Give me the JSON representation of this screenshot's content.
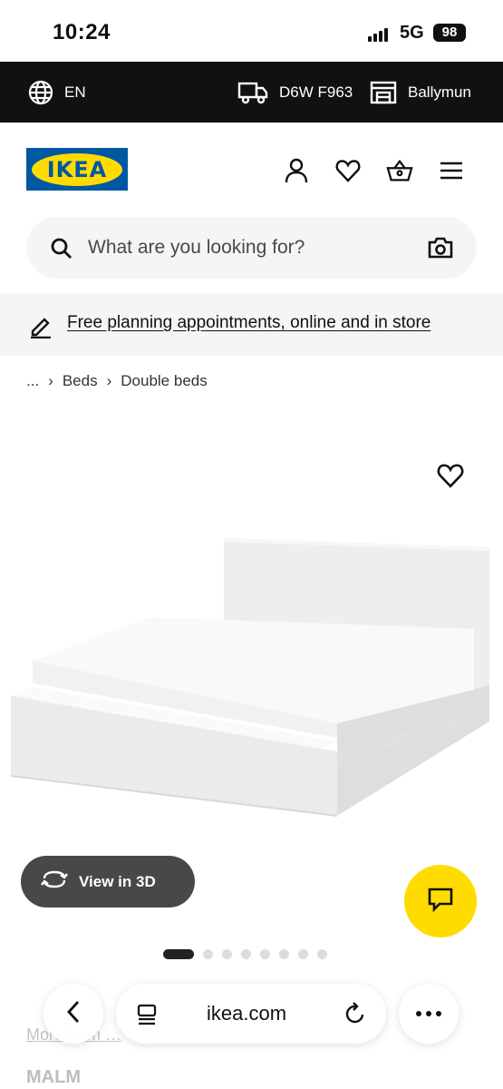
{
  "status_bar": {
    "time": "10:24",
    "network": "5G",
    "battery": "98"
  },
  "top_bar": {
    "language": "EN",
    "postcode": "D6W F963",
    "store": "Ballymun",
    "icons": [
      "globe-icon",
      "delivery-truck-icon",
      "store-icon"
    ]
  },
  "header": {
    "logo_text": "IKEA",
    "icons": [
      "profile-icon",
      "heart-icon",
      "basket-icon",
      "menu-icon"
    ]
  },
  "search": {
    "placeholder": "What are you looking for?",
    "icons": [
      "search-icon",
      "camera-icon"
    ]
  },
  "promo": {
    "text": "Free planning appointments, online and in store",
    "icon": "pencil-icon"
  },
  "breadcrumb": {
    "items": [
      "...",
      "Beds",
      "Double beds"
    ]
  },
  "gallery": {
    "view3d_label": "View in 3D",
    "dot_count": 8,
    "active_dot": 1
  },
  "below": {
    "link_text": "More from …",
    "product_name": "MALM"
  },
  "browser": {
    "url": "ikea.com"
  },
  "colors": {
    "brand_blue": "#0058a3",
    "brand_yellow": "#ffdb00",
    "dark": "#111111"
  }
}
